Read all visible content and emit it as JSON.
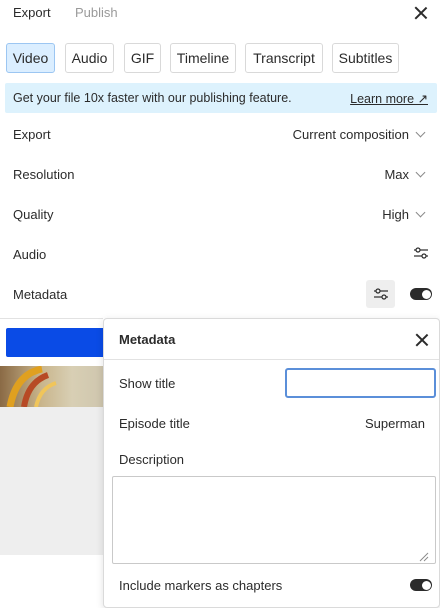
{
  "header": {
    "tabs": [
      {
        "label": "Export",
        "active": true
      },
      {
        "label": "Publish",
        "active": false
      }
    ]
  },
  "formats": [
    {
      "label": "Video",
      "active": true
    },
    {
      "label": "Audio",
      "active": false
    },
    {
      "label": "GIF",
      "active": false
    },
    {
      "label": "Timeline",
      "active": false
    },
    {
      "label": "Transcript",
      "active": false
    },
    {
      "label": "Subtitles",
      "active": false
    }
  ],
  "banner": {
    "text": "Get your file 10x faster with our publishing feature.",
    "link": "Learn more ↗"
  },
  "settings": [
    {
      "label": "Export",
      "value": "Current composition",
      "control": "dropdown"
    },
    {
      "label": "Resolution",
      "value": "Max",
      "control": "dropdown"
    },
    {
      "label": "Quality",
      "value": "High",
      "control": "dropdown"
    },
    {
      "label": "Audio",
      "value": "",
      "control": "sliders-icon"
    },
    {
      "label": "Metadata",
      "value": "",
      "control": "sliders-icon+toggle",
      "toggle_on": true
    }
  ],
  "metadata_popup": {
    "title": "Metadata",
    "show_title_label": "Show title",
    "show_title_value": "",
    "episode_title_label": "Episode title",
    "episode_title_value": "Superman",
    "description_label": "Description",
    "description_value": "",
    "chapters_label": "Include markers as chapters",
    "chapters_on": true
  },
  "colors": {
    "accent_blue": "#0a4be6",
    "banner_bg": "#ddf2fd",
    "active_tab_bg": "#dbeeff",
    "toggle_on": "#2b2b2b"
  }
}
